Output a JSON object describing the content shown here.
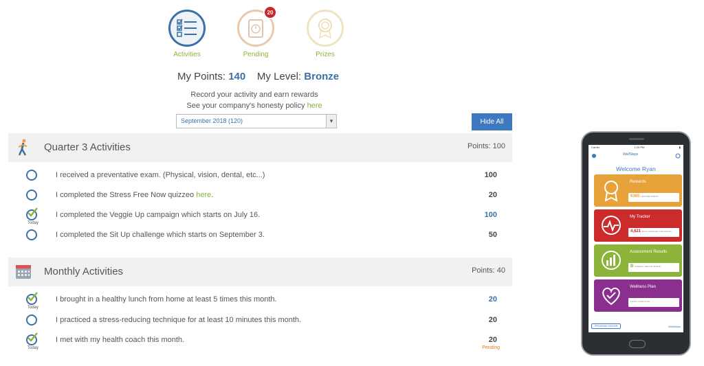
{
  "nav": {
    "activities_label": "Activities",
    "pending_label": "Pending",
    "pending_badge": "20",
    "prizes_label": "Prizes"
  },
  "summary": {
    "points_label": "My Points:",
    "points_value": "140",
    "level_label": "My Level:",
    "level_value": "Bronze"
  },
  "intro": {
    "line1": "Record your activity and earn rewards",
    "line2": "See your company's honesty policy",
    "policy_link": "here"
  },
  "period_select": {
    "value": "September 2018 (120)"
  },
  "hide_all_label": "Hide All",
  "sections": [
    {
      "title": "Quarter 3 Activities",
      "points": "Points: 100",
      "icon": "walking-person-icon",
      "rows": [
        {
          "text": "I received a preventative exam. (Physical, vision, dental, etc...)",
          "points": "100",
          "done": false
        },
        {
          "text": "I completed the Stress Free Now quizzeo",
          "link": "here",
          "suffix": ".",
          "points": "20",
          "done": false
        },
        {
          "text": "I completed the Veggie Up campaign which starts on July 16.",
          "points": "100",
          "done": true,
          "today": "Today"
        },
        {
          "text": "I completed the Sit Up challenge which starts on September 3.",
          "points": "50",
          "done": false
        }
      ]
    },
    {
      "title": "Monthly Activities",
      "points": "Points: 40",
      "icon": "calendar-icon",
      "rows": [
        {
          "text": "I brought in a healthy lunch from home at least 5 times this month.",
          "points": "20",
          "done": true,
          "today": "Today"
        },
        {
          "text": "I practiced a stress-reducing technique for at least 10 minutes this month.",
          "points": "20",
          "done": false
        },
        {
          "text": "I met with my health coach this month.",
          "points": "20",
          "done": true,
          "today": "Today",
          "status": "Pending"
        }
      ]
    }
  ],
  "phone": {
    "carrier": "Carrier",
    "time": "1:20 PM",
    "logo": "WellSteps",
    "welcome": "Welcome Ryan",
    "tiles": [
      {
        "title": "Rewards",
        "value": "6365",
        "caption": "LIFETIME POINTS"
      },
      {
        "title": "My Tracker",
        "value": "4,621",
        "caption": "DAILY AVERAGE THIS MONTH"
      },
      {
        "title": "Assessment Results",
        "value": "B",
        "caption": "OVERALL HEALTH GRADE"
      },
      {
        "title": "Wellness Plan",
        "value": "",
        "caption": "FINISH YOUR PLAN"
      }
    ],
    "program_center": "PROGRAM CENTER",
    "footer_brand": "WellSteps"
  }
}
